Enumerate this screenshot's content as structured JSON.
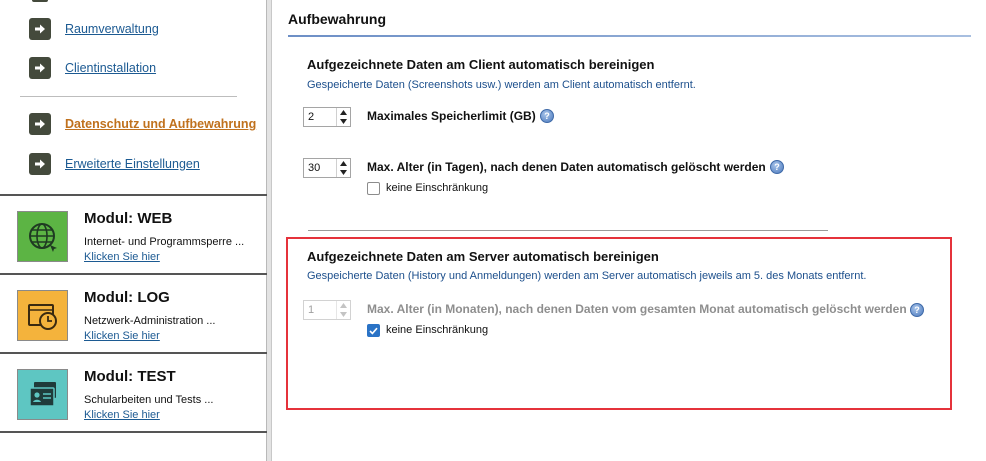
{
  "sidebar": {
    "nav": [
      {
        "label": "Raumverwaltung",
        "active": false
      },
      {
        "label": "Clientinstallation",
        "active": false
      },
      {
        "label": "Datenschutz und Aufbewahrung",
        "active": true
      },
      {
        "label": "Erweiterte Einstellungen",
        "active": false
      }
    ],
    "modules": [
      {
        "title": "Modul: WEB",
        "desc": "Internet- und Programmsperre ...",
        "link": "Klicken Sie hier",
        "icon": "globe-icon",
        "color": "#5cb444"
      },
      {
        "title": "Modul: LOG",
        "desc": "Netzwerk-Administration ...",
        "link": "Klicken Sie hier",
        "icon": "clock-folder-icon",
        "color": "#f4b33c"
      },
      {
        "title": "Modul: TEST",
        "desc": "Schularbeiten und Tests ...",
        "link": "Klicken Sie hier",
        "icon": "id-card-icon",
        "color": "#5ec6c2"
      }
    ]
  },
  "main": {
    "title": "Aufbewahrung",
    "client": {
      "heading": "Aufgezeichnete Daten am Client automatisch bereinigen",
      "desc": "Gespeicherte Daten (Screenshots usw.) werden am Client automatisch entfernt.",
      "storage_value": "2",
      "storage_label": "Maximales Speicherlimit (GB)",
      "age_value": "30",
      "age_label": "Max. Alter (in Tagen), nach denen Daten automatisch gelöscht werden",
      "no_limit_label": "keine Einschränkung",
      "no_limit_checked": false
    },
    "server": {
      "heading": "Aufgezeichnete Daten am Server automatisch bereinigen",
      "desc": "Gespeicherte Daten (History und Anmeldungen) werden am Server automatisch jeweils am 5. des Monats entfernt.",
      "age_value": "1",
      "age_label": "Max. Alter (in Monaten), nach denen Daten vom gesamten Monat automatisch gelöscht werden",
      "no_limit_label": "keine Einschränkung",
      "no_limit_checked": true
    },
    "help_glyph": "?"
  },
  "colors": {
    "link": "#1c5a92",
    "active_link": "#c0711d",
    "highlight": "#e5323b",
    "checkbox": "#2a73c6"
  }
}
